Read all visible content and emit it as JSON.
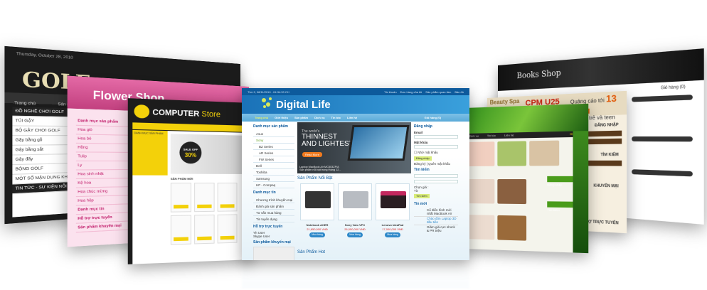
{
  "golf": {
    "logo": "GOLF",
    "date": "Thursday, October 28, 2010",
    "menu": [
      "Trang chủ",
      "Sản phẩm"
    ],
    "side_title": "ĐỒ NGHỀ CHƠI GOLF",
    "side_items": [
      "TÚI GẬY",
      "BỘ GẬY CHƠI GOLF",
      "Gậy bằng gỗ",
      "Gậy bằng sắt",
      "Gậy đẩy",
      "BÓNG GOLF",
      "MỘT SỐ MẶN DỤNG KHÁC"
    ],
    "news_title": "TIN TỨC - SỰ KIỆN NỔI BẬT"
  },
  "flower": {
    "title": "Flower Shop",
    "side_title": "Danh mục sản phẩm",
    "side_items": [
      "Hoa giỏ",
      "Hoa bó",
      "Hồng",
      "Tulip",
      "Ly",
      "Hoa sinh nhật",
      "Kệ hoa",
      "Hoa chúc mừng",
      "Hoa hộp"
    ],
    "news_title": "Danh mục tin",
    "support": "Hỗ trợ trực tuyến",
    "promo": "Sản phẩm khuyến mại"
  },
  "computer": {
    "brand": "COMPUTER",
    "brand_suffix": "Store",
    "sale": "SALE OFF",
    "sale_pct": "30%",
    "new_products": "SẢN PHẨM MỚI",
    "category": "DANH MỤC SẢN PHẨM"
  },
  "digital": {
    "date": "Thứ 2, 08/11/2010 - 04:34:33 CH",
    "top_links": [
      "Tài khoản",
      "Đơn hàng của tôi",
      "Sản phẩm quan tâm",
      "Bản đồ"
    ],
    "brand": "Digital Life",
    "nav": [
      "Trang chủ",
      "Giới thiệu",
      "Sản phẩm",
      "Dịch vụ",
      "Tin tức",
      "Liên hệ"
    ],
    "cart": "Giỏ hàng (0)",
    "cat_title": "Danh mục sản phẩm",
    "categories": [
      "Asus",
      "Sony",
      "BZ Series",
      "AR Series",
      "FW Series",
      "Dell",
      "Toshiba",
      "Samsung",
      "HP - Compaq"
    ],
    "news_title": "Danh mục tin",
    "news": [
      "Chương trình khuyến mại",
      "Đánh giá sản phẩm",
      "Tư vấn mua hàng",
      "Tin tuyển dụng"
    ],
    "support_title": "Hỗ trợ trực tuyến",
    "support": [
      "Yh User",
      "Skype User"
    ],
    "promo_title": "Sản phẩm khuyến mại",
    "banner": {
      "small": "The world's",
      "big1": "THINNEST",
      "big2": "AND LIGHTEST",
      "button": "Read More",
      "caption": "Laptop MacBook Air MC503ZP/A",
      "sub": "Sản phẩm nổi bật trong tháng 12..."
    },
    "featured_title": "Sản Phẩm Nổi Bật",
    "products": [
      {
        "name": "Notebook ACER",
        "price": "21,650,000 VNĐ",
        "buy": "Mua hàng"
      },
      {
        "name": "Sony Vaio VPC",
        "price": "26,050,000 VNĐ",
        "buy": "Mua hàng"
      },
      {
        "name": "Lenovo IdeaPad",
        "price": "17,000,000 VNĐ",
        "buy": "Mua hàng"
      }
    ],
    "hot_title": "Sản Phẩm Hot",
    "login": {
      "title": "Đăng nhập",
      "email": "Email",
      "password": "Mật khẩu",
      "remember": "Nhớ mật khẩu",
      "button": "Đăng nhập",
      "links": "Đăng ký | Quên mật khẩu"
    },
    "search": {
      "title": "Tìm kiếm",
      "price_label": "Chọn giá :",
      "from": "Từ",
      "button": "Tìm kiếm"
    },
    "latest_title": "Tin mới",
    "latest": [
      "Cổ điển hình mới nhất MacBook Air",
      "Chào đón Laptop 3D đầu tiên",
      "Giảm giá cực shock & PR triệu"
    ]
  },
  "spa": {
    "cart": "Giỏ hàng",
    "nav": [
      "Dịch vụ",
      "Tin tức",
      "Liên hệ"
    ],
    "login": "Đăng nhập",
    "search": "Tìm kiếm"
  },
  "beauty": {
    "title": "Beauty Spa",
    "ad": "CPM U25",
    "ad_text": "Quảng cáo tới",
    "ad_big": "13 triệu",
    "ad_sub": "độc giả trẻ và teen",
    "login": "ĐĂNG NHẬP",
    "search": "TÌM KIẾM",
    "promo": "KHUYẾN MẠI",
    "support": "HỖ TRỢ TRỰC TUYẾN"
  },
  "books": {
    "title": "Books Shop",
    "cart": "Giỏ hàng (0)"
  }
}
